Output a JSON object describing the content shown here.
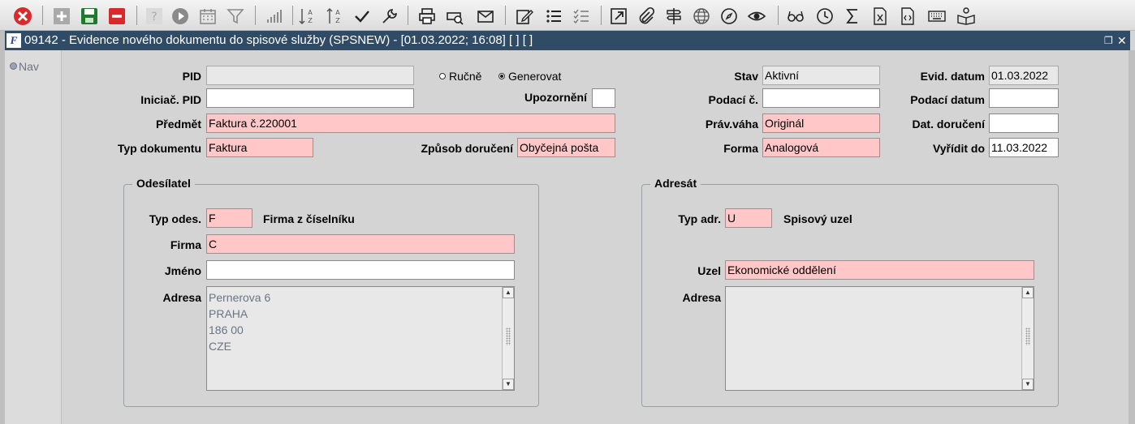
{
  "toolbar": {
    "icons": [
      "close-icon",
      "add-icon",
      "save-icon",
      "delete-icon",
      "help-icon",
      "play-icon",
      "calendar-icon",
      "filter-icon",
      "chart-bars-icon",
      "sort-asc-icon",
      "sort-desc-icon",
      "check-icon",
      "wrench-icon",
      "print-icon",
      "print-preview-icon",
      "mail-icon",
      "edit-icon",
      "list-icon",
      "checklist-icon",
      "open-external-icon",
      "attach-icon",
      "signpost-icon",
      "globe-icon",
      "compass-icon",
      "eye-icon",
      "glasses-icon",
      "clock-icon",
      "sum-icon",
      "excel-icon",
      "code-file-icon",
      "keyboard-icon",
      "reader-icon"
    ],
    "colors": {
      "close": "#d9292b",
      "save": "#1f7a2e",
      "delete": "#d9292b"
    }
  },
  "window": {
    "title": "09142 - Evidence nového dokumentu do spisové služby (SPSNEW) - [01.03.2022; 16:08]  [ ]  [ ]",
    "app_icon": "F"
  },
  "nav": {
    "label": "Nav"
  },
  "form": {
    "pid": {
      "label": "PID",
      "value": ""
    },
    "mode": {
      "manual_label": "Ručně",
      "generate_label": "Generovat",
      "selected": "Generovat"
    },
    "iniciac_pid": {
      "label": "Iniciač. PID",
      "value": ""
    },
    "upozorneni": {
      "label": "Upozornění",
      "value": ""
    },
    "predmet": {
      "label": "Předmět",
      "value": "Faktura č.220001"
    },
    "typ_dokumentu": {
      "label": "Typ dokumentu",
      "value": "Faktura"
    },
    "zpusob_doruceni": {
      "label": "Způsob doručení",
      "value": "Obyčejná pošta"
    },
    "stav": {
      "label": "Stav",
      "value": "Aktivní"
    },
    "podaci_c": {
      "label": "Podací č.",
      "value": ""
    },
    "prav_vaha": {
      "label": "Práv.váha",
      "value": "Originál"
    },
    "forma": {
      "label": "Forma",
      "value": "Analogová"
    },
    "evid_datum": {
      "label": "Evid. datum",
      "value": "01.03.2022"
    },
    "podaci_datum": {
      "label": "Podací datum",
      "value": ""
    },
    "dat_doruceni": {
      "label": "Dat. doručení",
      "value": ""
    },
    "vyridit_do": {
      "label": "Vyřídit do",
      "value": "11.03.2022"
    }
  },
  "odesilatel": {
    "title": "Odesílatel",
    "typ_odes": {
      "label": "Typ odes.",
      "value": "F",
      "desc": "Firma z číselníku"
    },
    "firma": {
      "label": "Firma",
      "value": "C"
    },
    "jmeno": {
      "label": "Jméno",
      "value": ""
    },
    "adresa": {
      "label": "Adresa",
      "lines": [
        "Pernerova 6",
        "PRAHA",
        "186 00",
        "CZE"
      ]
    }
  },
  "adresat": {
    "title": "Adresát",
    "typ_adr": {
      "label": "Typ adr.",
      "value": "U",
      "desc": "Spisový uzel"
    },
    "uzel": {
      "label": "Uzel",
      "value": "Ekonomické oddělení"
    },
    "adresa": {
      "label": "Adresa",
      "lines": []
    }
  }
}
